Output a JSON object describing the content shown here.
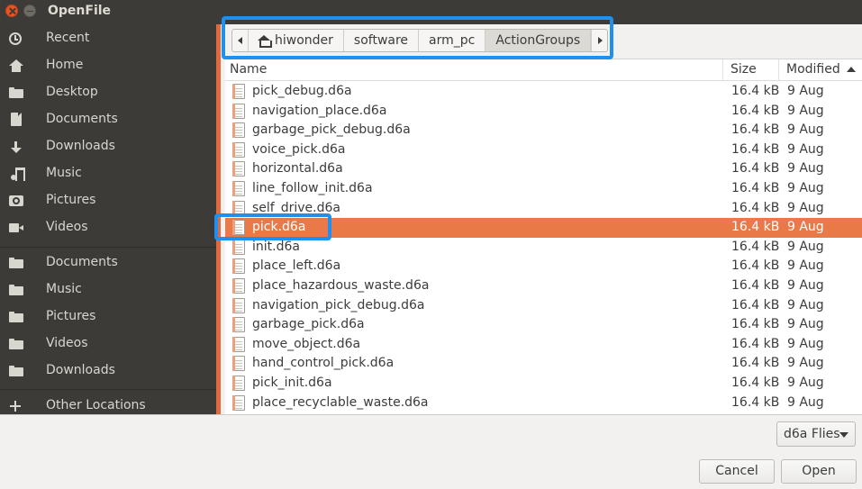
{
  "window": {
    "title": "OpenFile"
  },
  "sidebar": {
    "places": [
      {
        "label": "Recent",
        "icon": "clock-icon"
      },
      {
        "label": "Home",
        "icon": "home-icon"
      },
      {
        "label": "Desktop",
        "icon": "folder-icon"
      },
      {
        "label": "Documents",
        "icon": "document-icon"
      },
      {
        "label": "Downloads",
        "icon": "download-icon"
      },
      {
        "label": "Music",
        "icon": "music-icon"
      },
      {
        "label": "Pictures",
        "icon": "camera-icon"
      },
      {
        "label": "Videos",
        "icon": "video-icon"
      }
    ],
    "bookmarks": [
      {
        "label": "Documents",
        "icon": "folder-icon"
      },
      {
        "label": "Music",
        "icon": "folder-icon"
      },
      {
        "label": "Pictures",
        "icon": "folder-icon"
      },
      {
        "label": "Videos",
        "icon": "folder-icon"
      },
      {
        "label": "Downloads",
        "icon": "folder-icon"
      }
    ],
    "other": {
      "label": "Other Locations",
      "icon": "plus-icon"
    }
  },
  "pathbar": {
    "segments": [
      "hiwonder",
      "software",
      "arm_pc",
      "ActionGroups"
    ],
    "active": "ActionGroups"
  },
  "columns": {
    "name": "Name",
    "size": "Size",
    "modified": "Modified"
  },
  "files": [
    {
      "name": "pick_debug.d6a",
      "size": "16.4 kB",
      "modified": "9 Aug"
    },
    {
      "name": "navigation_place.d6a",
      "size": "16.4 kB",
      "modified": "9 Aug"
    },
    {
      "name": "garbage_pick_debug.d6a",
      "size": "16.4 kB",
      "modified": "9 Aug"
    },
    {
      "name": "voice_pick.d6a",
      "size": "16.4 kB",
      "modified": "9 Aug"
    },
    {
      "name": "horizontal.d6a",
      "size": "16.4 kB",
      "modified": "9 Aug"
    },
    {
      "name": "line_follow_init.d6a",
      "size": "16.4 kB",
      "modified": "9 Aug"
    },
    {
      "name": "self_drive.d6a",
      "size": "16.4 kB",
      "modified": "9 Aug"
    },
    {
      "name": "pick.d6a",
      "size": "16.4 kB",
      "modified": "9 Aug",
      "selected": true
    },
    {
      "name": "init.d6a",
      "size": "16.4 kB",
      "modified": "9 Aug"
    },
    {
      "name": "place_left.d6a",
      "size": "16.4 kB",
      "modified": "9 Aug"
    },
    {
      "name": "place_hazardous_waste.d6a",
      "size": "16.4 kB",
      "modified": "9 Aug"
    },
    {
      "name": "navigation_pick_debug.d6a",
      "size": "16.4 kB",
      "modified": "9 Aug"
    },
    {
      "name": "garbage_pick.d6a",
      "size": "16.4 kB",
      "modified": "9 Aug"
    },
    {
      "name": "move_object.d6a",
      "size": "16.4 kB",
      "modified": "9 Aug"
    },
    {
      "name": "hand_control_pick.d6a",
      "size": "16.4 kB",
      "modified": "9 Aug"
    },
    {
      "name": "pick_init.d6a",
      "size": "16.4 kB",
      "modified": "9 Aug"
    },
    {
      "name": "place_recyclable_waste.d6a",
      "size": "16.4 kB",
      "modified": "9 Aug"
    }
  ],
  "filter": {
    "label": "d6a Flies"
  },
  "buttons": {
    "cancel": "Cancel",
    "open": "Open"
  },
  "colors": {
    "accent": "#e97a48",
    "annotation": "#1e90f0",
    "sidebar_bg": "#3c3b37"
  }
}
